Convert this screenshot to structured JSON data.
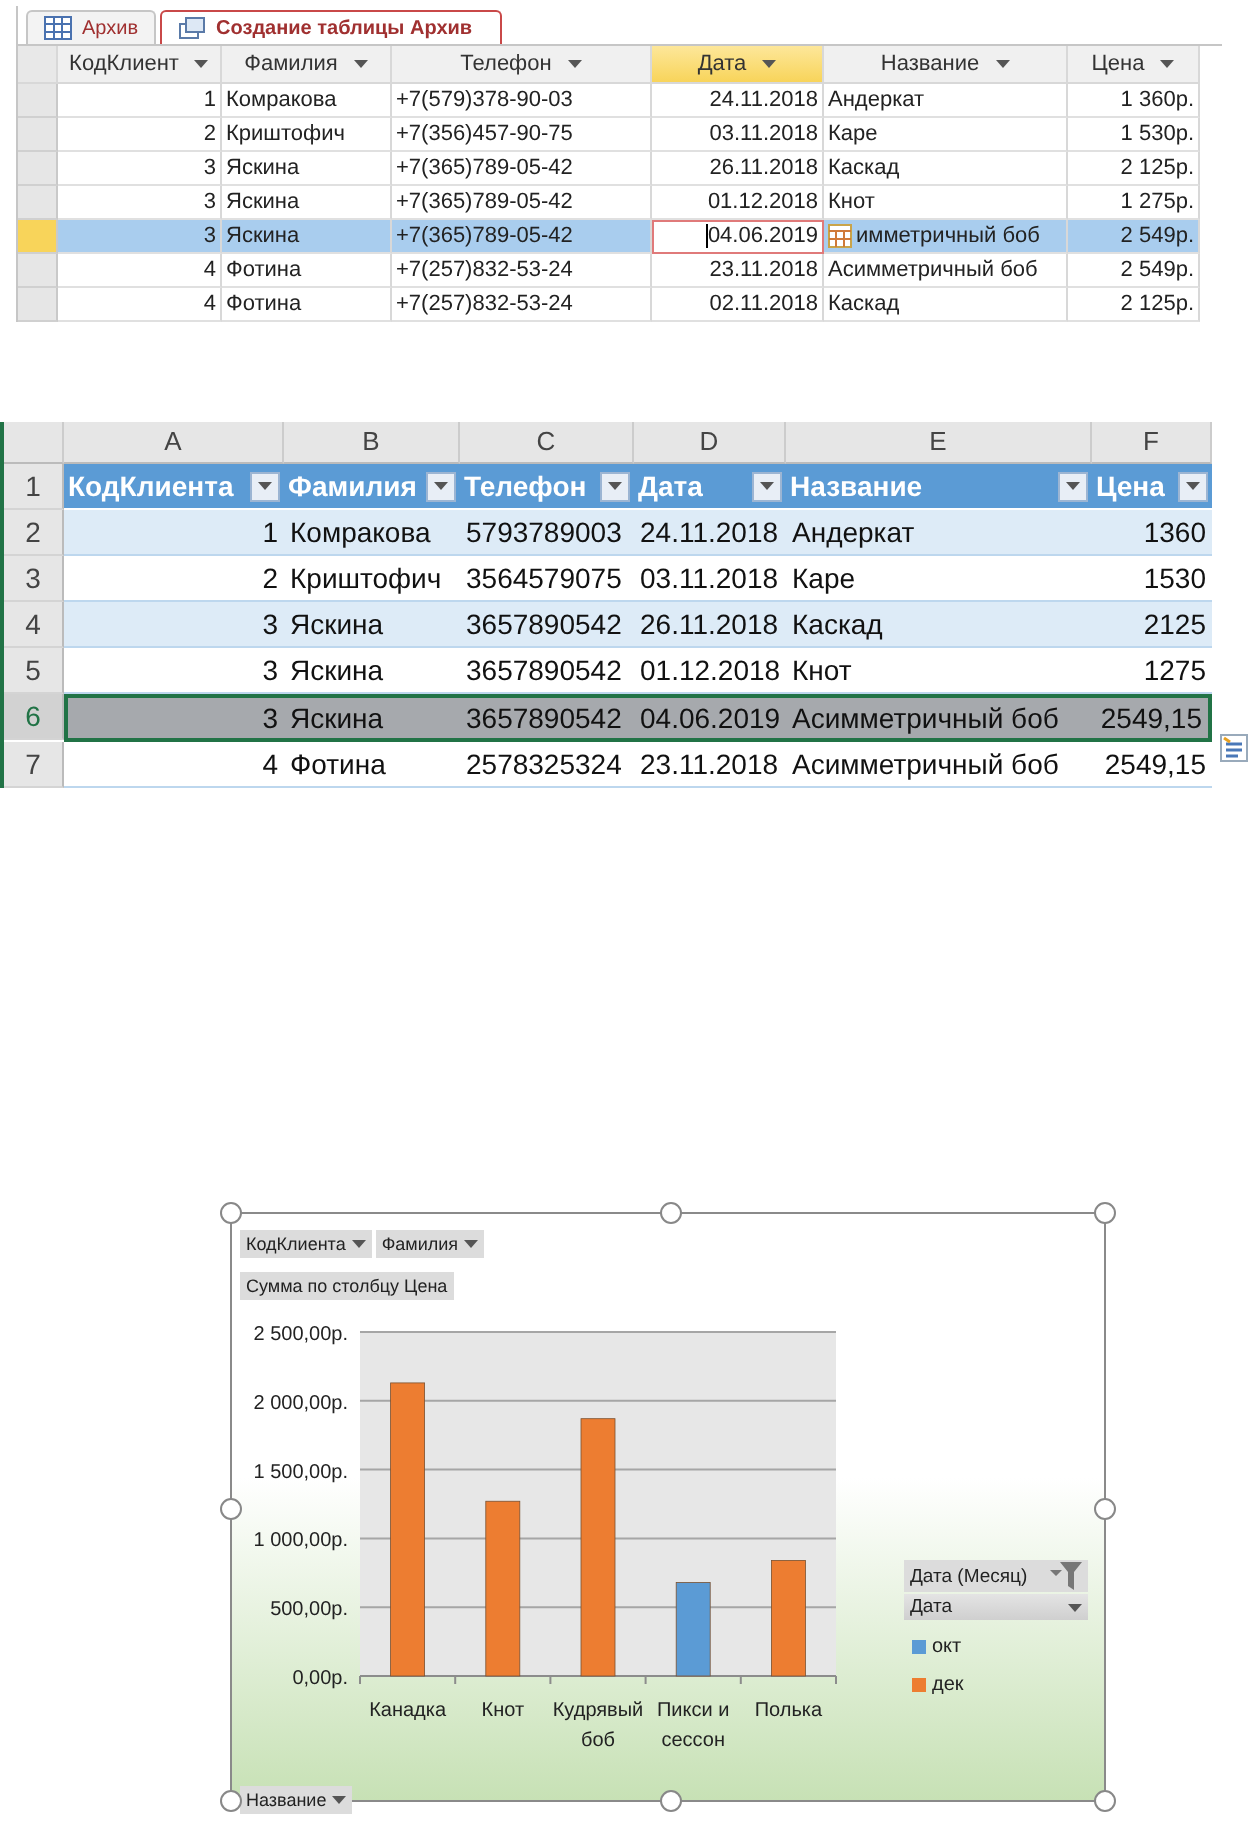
{
  "access": {
    "tabs": [
      {
        "label": "Архив",
        "selected": false,
        "kind": "table"
      },
      {
        "label": "Создание таблицы Архив",
        "selected": true,
        "kind": "query"
      }
    ],
    "columns": [
      {
        "label": "КодКлиент",
        "selected": false
      },
      {
        "label": "Фамилия",
        "selected": false
      },
      {
        "label": "Телефон",
        "selected": false
      },
      {
        "label": "Дата",
        "selected": true
      },
      {
        "label": "Название",
        "selected": false
      },
      {
        "label": "Цена",
        "selected": false
      }
    ],
    "rows": [
      {
        "selected": false,
        "editing": false,
        "cells": [
          "1",
          "Комракова",
          "+7(579)378-90-03",
          "24.11.2018",
          "Андеркат",
          "1 360р."
        ]
      },
      {
        "selected": false,
        "editing": false,
        "cells": [
          "2",
          "Криштофич",
          "+7(356)457-90-75",
          "03.11.2018",
          "Каре",
          "1 530р."
        ]
      },
      {
        "selected": false,
        "editing": false,
        "cells": [
          "3",
          "Яскина",
          "+7(365)789-05-42",
          "26.11.2018",
          "Каскад",
          "2 125р."
        ]
      },
      {
        "selected": false,
        "editing": false,
        "cells": [
          "3",
          "Яскина",
          "+7(365)789-05-42",
          "01.12.2018",
          "Кнот",
          "1 275р."
        ]
      },
      {
        "selected": true,
        "editing": true,
        "cells": [
          "3",
          "Яскина",
          "+7(365)789-05-42",
          "04.06.2019",
          "имметричный боб",
          "2 549р."
        ]
      },
      {
        "selected": false,
        "editing": false,
        "cells": [
          "4",
          "Фотина",
          "+7(257)832-53-24",
          "23.11.2018",
          "Асимметричный боб",
          "2 549р."
        ]
      },
      {
        "selected": false,
        "editing": false,
        "cells": [
          "4",
          "Фотина",
          "+7(257)832-53-24",
          "02.11.2018",
          "Каскад",
          "2 125р."
        ]
      }
    ]
  },
  "excel": {
    "column_letters": [
      "A",
      "B",
      "C",
      "D",
      "E",
      "F"
    ],
    "header": {
      "row": "1",
      "cells": [
        "КодКлиента",
        "Фамилия",
        "Телефон",
        "Дата",
        "Название",
        "Цена"
      ]
    },
    "rows": [
      {
        "row": "2",
        "selected": false,
        "cells": [
          "1",
          "Комракова",
          "5793789003",
          "24.11.2018",
          "Андеркат",
          "1360"
        ]
      },
      {
        "row": "3",
        "selected": false,
        "cells": [
          "2",
          "Криштофич",
          "3564579075",
          "03.11.2018",
          "Каре",
          "1530"
        ]
      },
      {
        "row": "4",
        "selected": false,
        "cells": [
          "3",
          "Яскина",
          "3657890542",
          "26.11.2018",
          "Каскад",
          "2125"
        ]
      },
      {
        "row": "5",
        "selected": false,
        "cells": [
          "3",
          "Яскина",
          "3657890542",
          "01.12.2018",
          "Кнот",
          "1275"
        ]
      },
      {
        "row": "6",
        "selected": true,
        "cells": [
          "3",
          "Яскина",
          "3657890542",
          "04.06.2019",
          "Асимметричный боб",
          "2549,15"
        ]
      },
      {
        "row": "7",
        "selected": false,
        "cells": [
          "4",
          "Фотина",
          "2578325324",
          "23.11.2018",
          "Асимметричный боб",
          "2549,15"
        ]
      }
    ]
  },
  "pivot_chart": {
    "filter_fields": [
      "КодКлиента",
      "Фамилия"
    ],
    "value_field": "Сумма по столбцу Цена",
    "axis_field": "Название",
    "legend_title": "Дата (Месяц)",
    "legend_field": "Дата",
    "chart_data": {
      "type": "bar",
      "categories": [
        "Канадка",
        "Кнот",
        "Кудрявый боб",
        "Пикси и сессон",
        "Полька"
      ],
      "series": [
        {
          "name": "окт",
          "color": "#5b9bd5",
          "values": [
            null,
            null,
            null,
            680,
            null
          ]
        },
        {
          "name": "дек",
          "color": "#ed7d31",
          "values": [
            2130,
            1270,
            1870,
            null,
            840
          ]
        }
      ],
      "ylim": [
        0,
        2500
      ],
      "grid": true,
      "yticks": [
        {
          "value": 0,
          "label": "0,00р."
        },
        {
          "value": 500,
          "label": "500,00р."
        },
        {
          "value": 1000,
          "label": "1 000,00р."
        },
        {
          "value": 1500,
          "label": "1 500,00р."
        },
        {
          "value": 2000,
          "label": "2 000,00р."
        },
        {
          "value": 2500,
          "label": "2 500,00р."
        }
      ]
    }
  }
}
